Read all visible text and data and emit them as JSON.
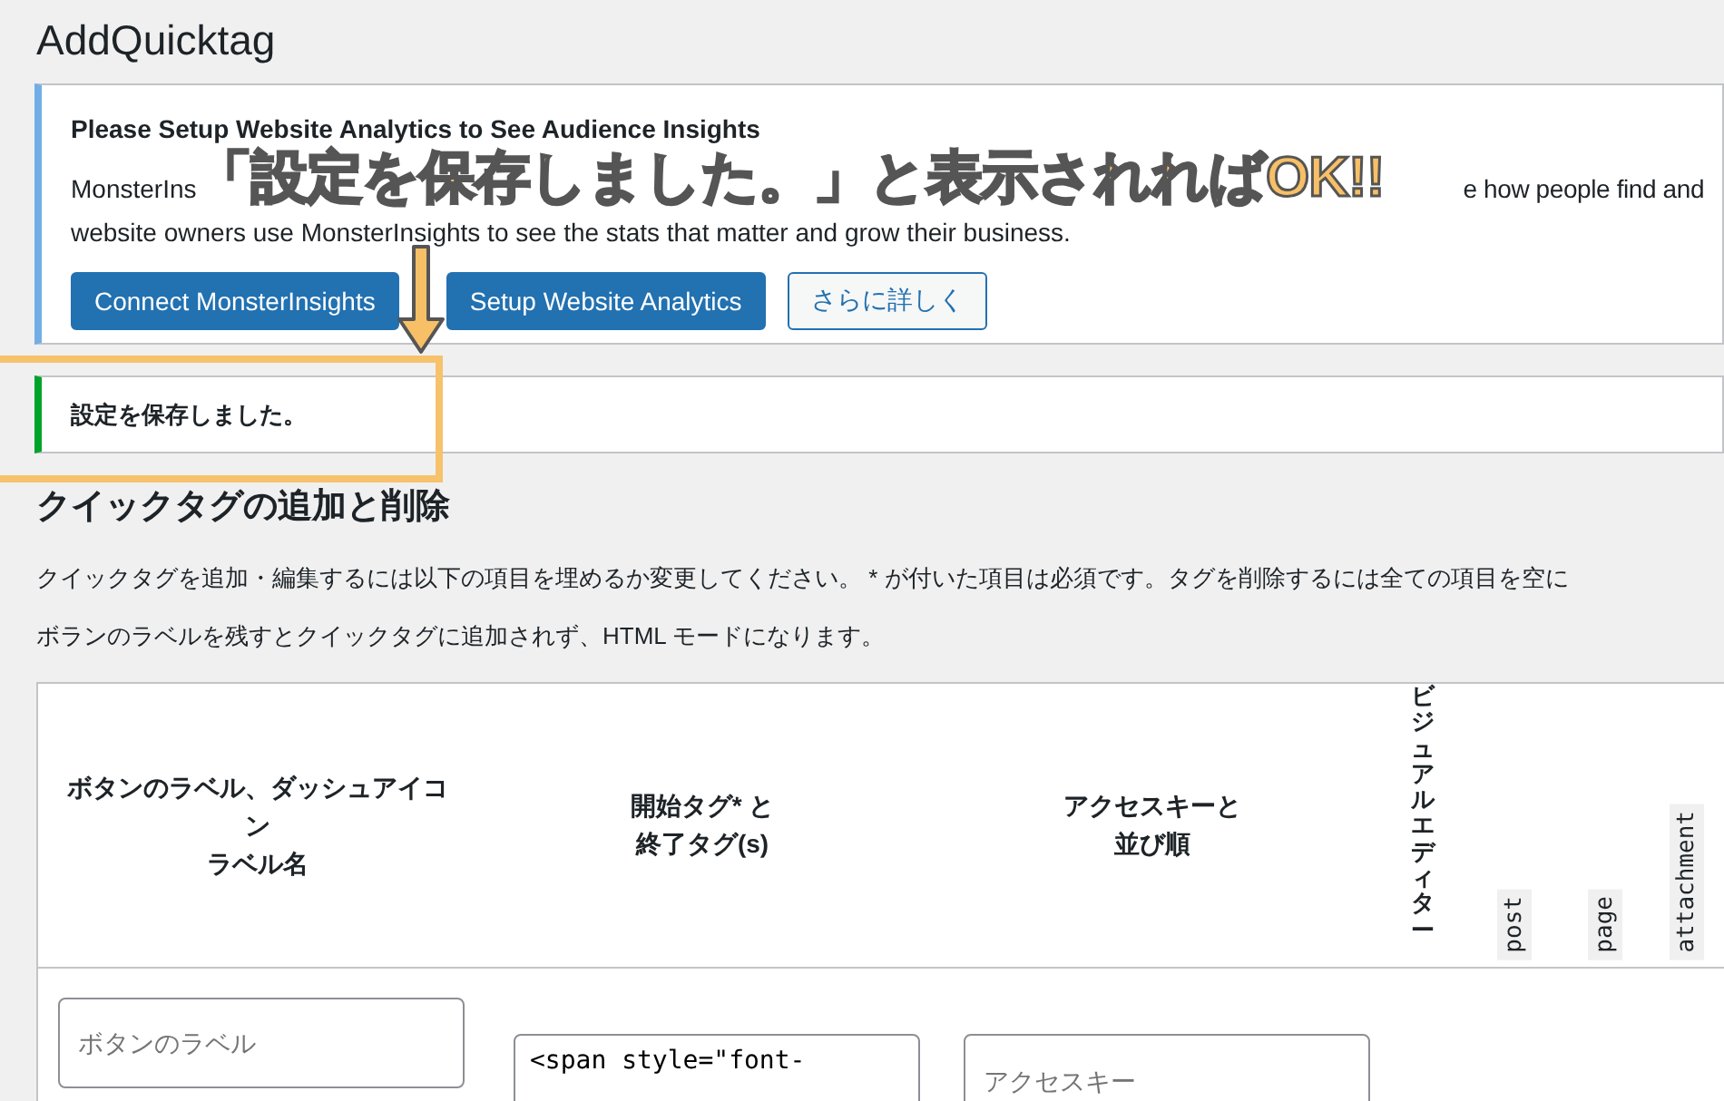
{
  "page": {
    "title": "AddQuicktag"
  },
  "analytics_notice": {
    "heading": "Please Setup Website Analytics to See Audience Insights",
    "text_fragments": [
      "MonsterIns",
      "e how people find and"
    ],
    "text_line_2": "website owners use MonsterInsights to see the stats that matter and grow their business.",
    "buttons": [
      {
        "label": "Connect MonsterInsights",
        "kind": "primary"
      },
      {
        "label": "Setup Website Analytics",
        "kind": "primary"
      },
      {
        "label": "さらに詳しく",
        "kind": "secondary"
      }
    ]
  },
  "success_notice": {
    "text": "設定を保存しました。"
  },
  "section": {
    "heading": "クイックタグの追加と削除",
    "paragraphs": [
      "クイックタグを追加・編集するには以下の項目を埋めるか変更してください。 * が付いた項目は必須です。タグを削除するには全ての項目を空に",
      "ボランのラベルを残すとクイックタグに追加されず、HTML モードになります。"
    ]
  },
  "table": {
    "columns": [
      {
        "lines": [
          "ボタンのラベル、ダッシュアイコ",
          "ン",
          "ラベル名"
        ],
        "kind": "text"
      },
      {
        "lines": [
          "開始タグ* と",
          "終了タグ(s)"
        ],
        "kind": "text"
      },
      {
        "lines": [
          "アクセスキーと",
          "並び順"
        ],
        "kind": "text"
      },
      {
        "lines": [
          "ビジュアルエディター"
        ],
        "kind": "vertical"
      },
      {
        "lines": [
          "post"
        ],
        "kind": "rotated"
      },
      {
        "lines": [
          "page"
        ],
        "kind": "rotated"
      },
      {
        "lines": [
          "attachment"
        ],
        "kind": "rotated"
      }
    ],
    "new_row": {
      "label_placeholder": "ボタンのラベル",
      "start_tag_value": "<span style=\"font-",
      "access_key_placeholder": "アクセスキー"
    }
  },
  "annotation": {
    "callout": "「設定を保存しました。」と表示されればOK!!"
  }
}
